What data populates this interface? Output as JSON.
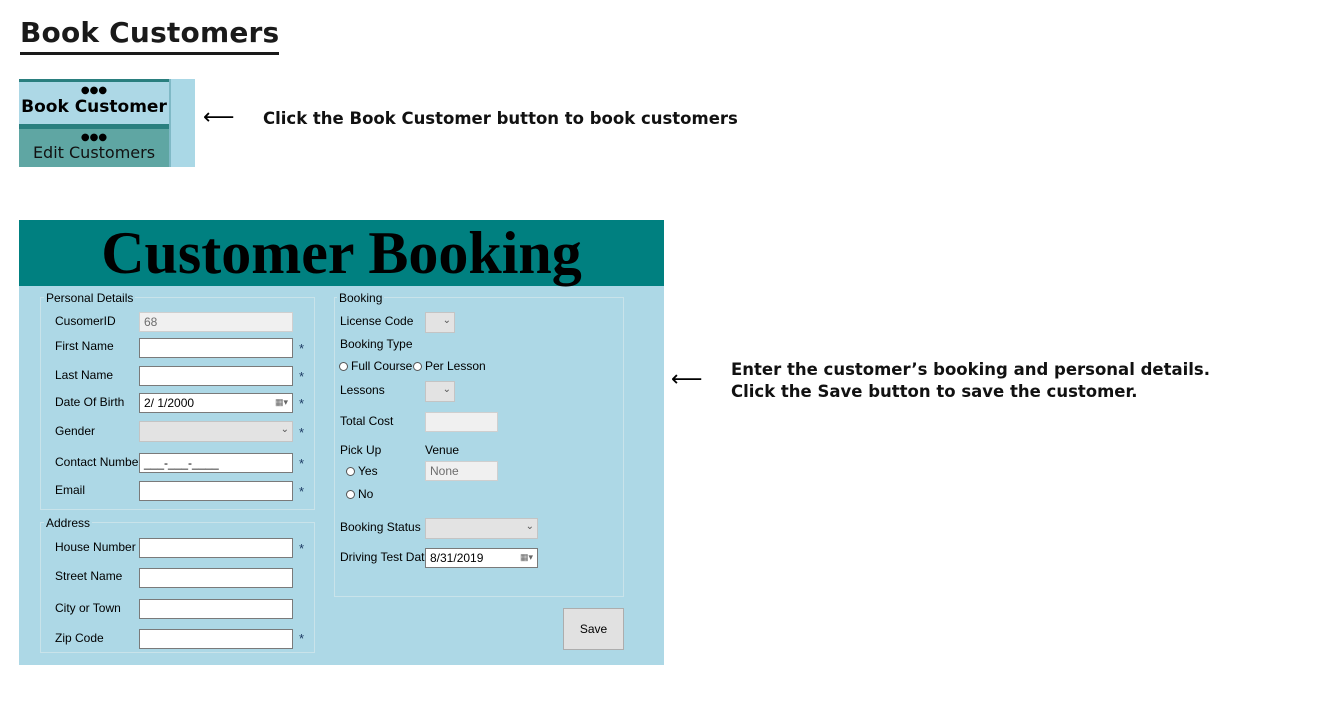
{
  "page": {
    "title": "Book Customers"
  },
  "nav": {
    "active_label": "Book Customer",
    "inactive_label": "Edit Customers",
    "icon": "people-icon"
  },
  "callouts": {
    "nav_hint": "Click the Book Customer button to book customers",
    "form_hint_line1": "Enter the customer’s booking and personal details.",
    "form_hint_line2": "Click the Save button to save the customer."
  },
  "form": {
    "title": "Customer Booking",
    "personal": {
      "group_title": "Personal Details",
      "customer_id_label": "CusomerID",
      "customer_id_value": "68",
      "first_name_label": "First Name",
      "first_name_value": "",
      "last_name_label": "Last Name",
      "last_name_value": "",
      "dob_label": "Date Of Birth",
      "dob_value": "2/  1/2000",
      "gender_label": "Gender",
      "gender_value": "",
      "contact_label": "Contact Number",
      "contact_value": "___-___-____",
      "email_label": "Email",
      "email_value": "",
      "required_mark": "*"
    },
    "address": {
      "group_title": "Address",
      "house_label": "House Number",
      "street_label": "Street Name",
      "city_label": "City or Town",
      "zip_label": "Zip Code"
    },
    "booking": {
      "group_title": "Booking",
      "license_label": "License Code",
      "booking_type_label": "Booking Type",
      "full_course_label": "Full Course",
      "per_lesson_label": "Per Lesson",
      "lessons_label": "Lessons",
      "total_cost_label": "Total Cost",
      "pickup_label": "Pick Up",
      "venue_label": "Venue",
      "yes_label": "Yes",
      "no_label": "No",
      "venue_placeholder": "None",
      "booking_status_label": "Booking Status",
      "driving_test_label": "Driving Test Date",
      "driving_test_value": "8/31/2019"
    },
    "save_label": "Save"
  }
}
